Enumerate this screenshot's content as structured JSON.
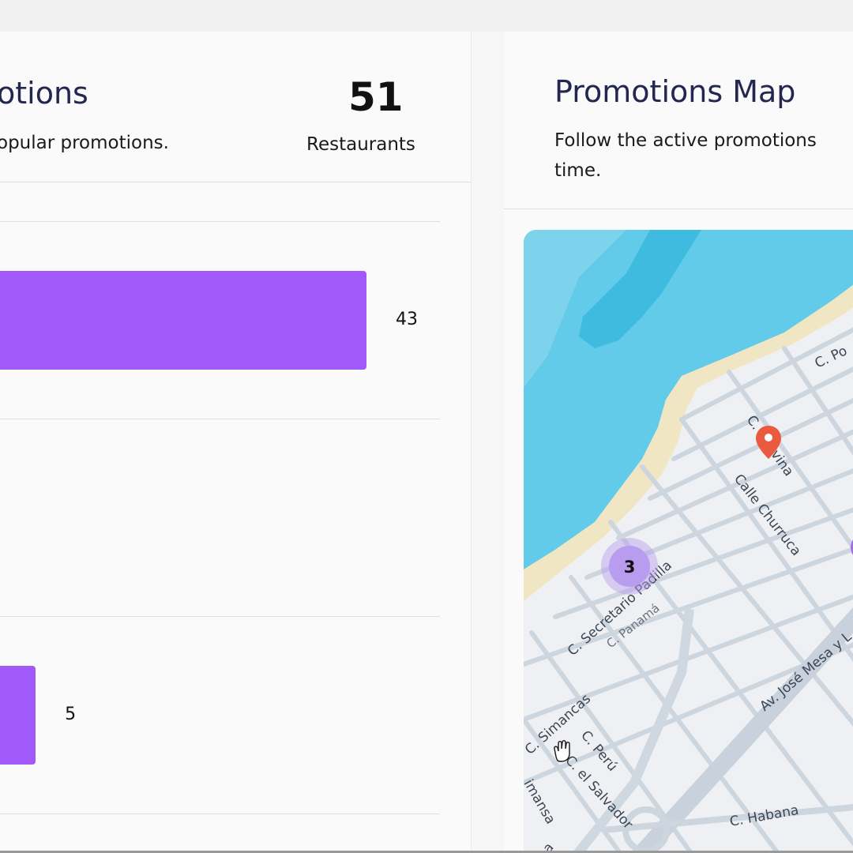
{
  "left_panel": {
    "title": "otions",
    "subtitle": "opular promotions.",
    "kpi": {
      "value": "51",
      "label": "Restaurants"
    },
    "chart_data": {
      "type": "bar",
      "orientation": "horizontal",
      "categories": [],
      "values": [
        43,
        5
      ],
      "value_labels": [
        "43",
        "5"
      ],
      "xlim": [
        0,
        46
      ],
      "color": "#a259fa"
    }
  },
  "right_panel": {
    "title": "Promotions Map",
    "subtitle_line1": "Follow the active promotions",
    "subtitle_line2": "time.",
    "map": {
      "cluster_count": "3",
      "streets": [
        "C. Po",
        "C. Gravina",
        "Calle Churruca",
        "C. Secretario Padilla",
        "C. Panamá",
        "Av. José Mesa y L",
        "C. Simancas",
        "C. Perú",
        "C. el Salvador",
        "imansa",
        "C. Habana",
        "a"
      ],
      "colors": {
        "sea": "#62cbe9",
        "sea_deep": "#3fbbe0",
        "beach": "#f1e6c4",
        "land": "#eef0f3",
        "road": "#cdd5df",
        "marker": "#ea5a3f",
        "cluster": "#b79cf0"
      }
    }
  }
}
